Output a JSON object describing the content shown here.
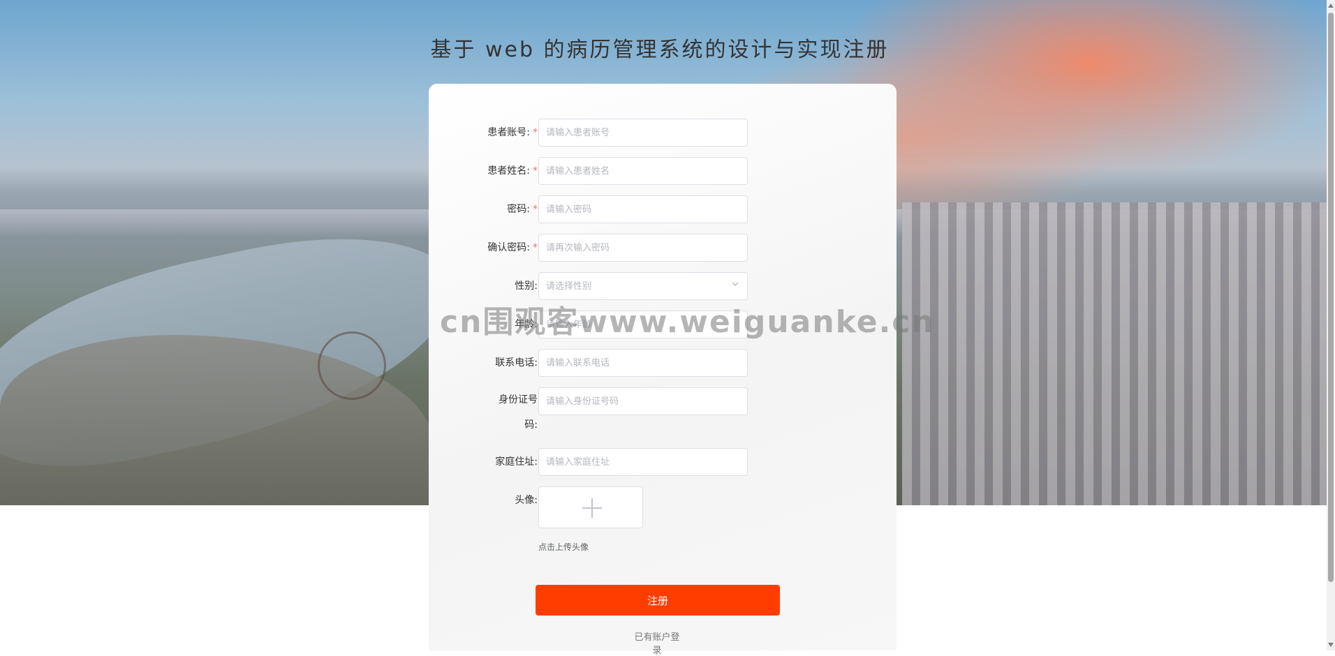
{
  "page": {
    "title": "基于 web 的病历管理系统的设计与实现注册",
    "watermark": "cn围观客www.weiguanke.cn"
  },
  "form": {
    "fields": [
      {
        "label": "患者账号:",
        "placeholder": "请输入患者账号",
        "required": true
      },
      {
        "label": "患者姓名:",
        "placeholder": "请输入患者姓名",
        "required": true
      },
      {
        "label": "密码:",
        "placeholder": "请输入密码",
        "required": true
      },
      {
        "label": "确认密码:",
        "placeholder": "请再次输入密码",
        "required": true
      },
      {
        "label": "性别:",
        "placeholder": "请选择性别",
        "required": false
      },
      {
        "label": "年龄:",
        "placeholder": "请输入年龄",
        "required": false
      },
      {
        "label": "联系电话:",
        "placeholder": "请输入联系电话",
        "required": false
      },
      {
        "label": "身份证号码:",
        "placeholder": "请输入身份证号码",
        "required": false
      },
      {
        "label": "家庭住址:",
        "placeholder": "请输入家庭住址",
        "required": false
      }
    ],
    "required_mark": "*",
    "avatar_label": "头像:",
    "avatar_hint": "点击上传头像",
    "submit_label": "注册",
    "login_link": "已有账户登录"
  },
  "colors": {
    "primary": "#ff3d00",
    "required": "#f56c6c"
  }
}
